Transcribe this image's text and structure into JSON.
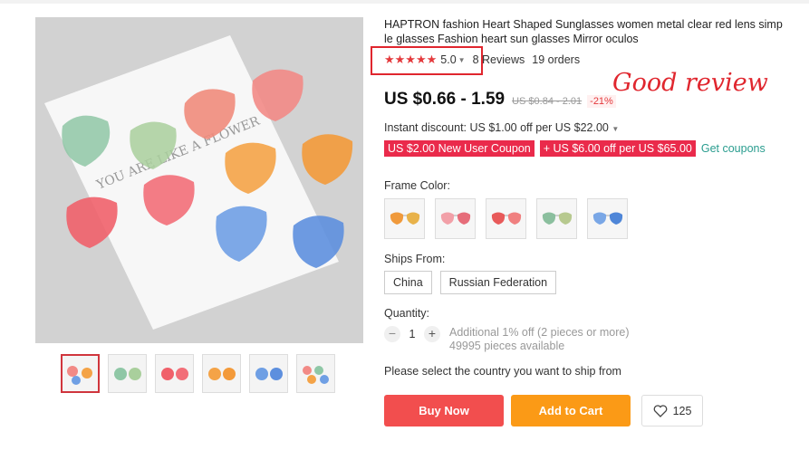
{
  "product": {
    "title": "HAPTRON fashion Heart Shaped Sunglasses women metal clear red lens simple glasses Fashion heart sun glasses Mirror oculos",
    "image_text": "YOU ARE LIKE A FLOWER",
    "rating": {
      "stars": "★★★★★",
      "value": "5.0",
      "reviews": "8 Reviews",
      "orders": "19 orders"
    },
    "overlay_annotation": "Good review",
    "price": {
      "current": "US $0.66 - 1.59",
      "original": "US $0.84 - 2.01",
      "discount": "-21%"
    },
    "instant_discount": "Instant discount: US $1.00 off per US $22.00",
    "coupons": [
      "US $2.00 New User Coupon",
      "+ US $6.00 off per US $65.00"
    ],
    "get_coupons": "Get coupons",
    "frame_color_label": "Frame Color:",
    "frame_colors": [
      {
        "left": "#f09a3c",
        "right": "#e8b24a"
      },
      {
        "left": "#f2a0a8",
        "right": "#e66d7a"
      },
      {
        "left": "#e85a5a",
        "right": "#f08080"
      },
      {
        "left": "#8bbf9e",
        "right": "#b7c98f"
      },
      {
        "left": "#7aa7e6",
        "right": "#4f86d8"
      }
    ],
    "ships_from_label": "Ships From:",
    "ships_from": [
      "China",
      "Russian Federation"
    ],
    "quantity_label": "Quantity:",
    "quantity": {
      "minus": "−",
      "value": "1",
      "plus": "+",
      "note": "Additional 1% off (2 pieces or more)",
      "available": "49995 pieces available"
    },
    "ship_note": "Please select the country you want to ship from",
    "buttons": {
      "buy_now": "Buy Now",
      "add_to_cart": "Add to Cart",
      "wishlist_count": "125"
    }
  },
  "colors": {
    "accent_red": "#e4393c",
    "buy_button": "#f24e4e",
    "cart_button": "#fb9a16",
    "coupon": "#ea2a4b",
    "link_green": "#2a9d8f"
  }
}
